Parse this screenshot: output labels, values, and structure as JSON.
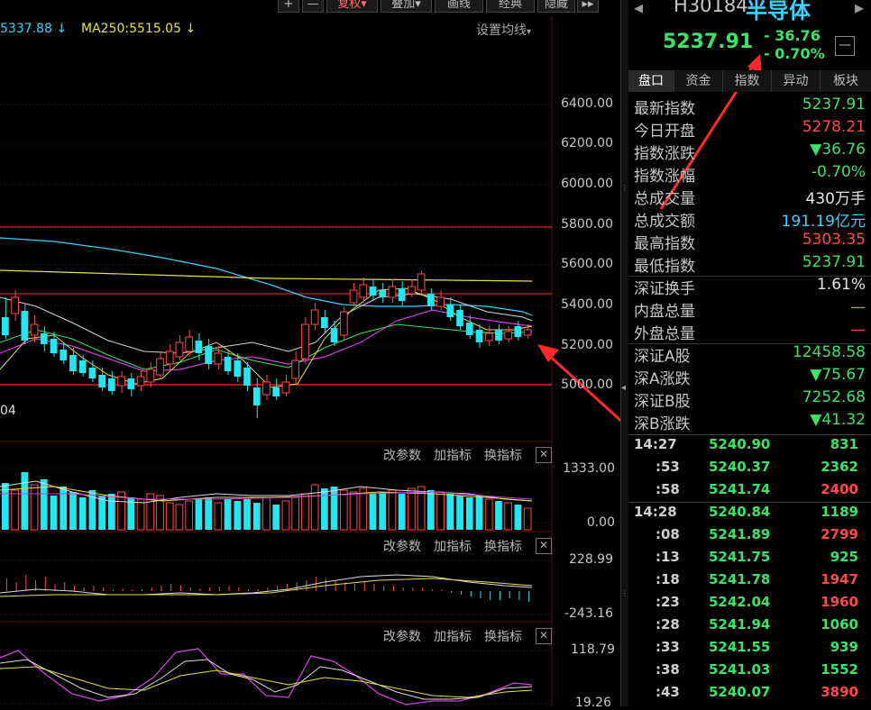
{
  "toolbar": {
    "plus": "+",
    "minus": "—",
    "fuquan": "复权",
    "fuquan_arrow": "▾",
    "overlay": "叠加",
    "overlay_arrow": "▾",
    "draw": "画线",
    "classic": "经典",
    "hide": "隐藏",
    "expand": "▸▸"
  },
  "ma_legend": {
    "ma_a": "5337.88",
    "ma_a_color": "#3bd1ff",
    "ma_a_arrow": "↓",
    "ma250": "MA250:5515.05",
    "ma250_color": "#e8e04a",
    "ma250_arrow": "↓",
    "settings": "设置均线",
    "settings_arrow": "▾"
  },
  "price_axis": [
    "6400.00",
    "6200.00",
    "6000.00",
    "5800.00",
    "5600.00",
    "5400.00",
    "5200.00",
    "5000.00"
  ],
  "date_label": "04",
  "panel_controls": {
    "modify": "改参数",
    "add": "加指标",
    "switch": "换指标",
    "close": "✕"
  },
  "volume_axis": [
    "1333.00",
    "0.00"
  ],
  "macd_axis": [
    "228.99",
    "-243.16"
  ],
  "kdj_axis": [
    "118.79",
    "19.26"
  ],
  "header": {
    "code": "H30184",
    "name": "半导体",
    "price": "5237.91",
    "change": "- 36.76",
    "change_pct": "- 0.70%",
    "collapse": "—"
  },
  "tabs": [
    "盘口",
    "资金",
    "指数",
    "异动",
    "板块"
  ],
  "quote_rows": [
    {
      "label": "最新指数",
      "value": "5237.91",
      "color": "#3ce36a"
    },
    {
      "label": "今日开盘",
      "value": "5278.21",
      "color": "#ff4a4a"
    },
    {
      "label": "指数涨跌",
      "value": "▼36.76",
      "color": "#3ce36a"
    },
    {
      "label": "指数涨幅",
      "value": "-0.70%",
      "color": "#3ce36a"
    },
    {
      "label": "总成交量",
      "value": "430万手",
      "color": "#e6e6e6"
    },
    {
      "label": "总成交额",
      "value": "191.19亿元",
      "color": "#3bd1ff"
    },
    {
      "label": "最高指数",
      "value": "5303.35",
      "color": "#ff4a4a"
    },
    {
      "label": "最低指数",
      "value": "5237.91",
      "color": "#3ce36a"
    }
  ],
  "quote_rows_2": [
    {
      "label": "深证换手",
      "value": "1.61%",
      "color": "#e6e6e6"
    },
    {
      "label": "内盘总量",
      "value": "—",
      "color": "#3ce36a"
    },
    {
      "label": "外盘总量",
      "value": "—",
      "color": "#ff4a4a"
    }
  ],
  "quote_rows_3": [
    {
      "label": "深证A股",
      "value": "12458.58",
      "color": "#3ce36a"
    },
    {
      "label": "深A涨跌",
      "value": "▼75.67",
      "color": "#3ce36a"
    },
    {
      "label": "深证B股",
      "value": "7252.68",
      "color": "#3ce36a"
    },
    {
      "label": "深B涨跌",
      "value": "▼41.32",
      "color": "#3ce36a"
    }
  ],
  "ticks_1": [
    {
      "time": "14:27",
      "price": "5240.90",
      "vol": "831",
      "color": "#3ce36a"
    },
    {
      "time": ":53",
      "price": "5240.37",
      "vol": "2362",
      "color": "#3ce36a"
    },
    {
      "time": ":58",
      "price": "5241.74",
      "vol": "2400",
      "color": "#ff4a4a"
    }
  ],
  "ticks_2": [
    {
      "time": "14:28",
      "price": "5240.84",
      "vol": "1189",
      "color": "#3ce36a"
    },
    {
      "time": ":08",
      "price": "5241.89",
      "vol": "2799",
      "color": "#ff4a4a"
    },
    {
      "time": ":13",
      "price": "5241.75",
      "vol": "925",
      "color": "#3ce36a"
    },
    {
      "time": ":18",
      "price": "5241.78",
      "vol": "1947",
      "color": "#ff4a4a"
    },
    {
      "time": ":23",
      "price": "5242.04",
      "vol": "1960",
      "color": "#ff4a4a"
    },
    {
      "time": ":28",
      "price": "5241.94",
      "vol": "1060",
      "color": "#3ce36a"
    },
    {
      "time": ":33",
      "price": "5241.55",
      "vol": "939",
      "color": "#3ce36a"
    },
    {
      "time": ":38",
      "price": "5241.03",
      "vol": "1552",
      "color": "#3ce36a"
    },
    {
      "time": ":43",
      "price": "5240.07",
      "vol": "3890",
      "color": "#ff4a4a"
    }
  ],
  "colors": {
    "up": "#ff4a4a",
    "down": "#3ce36a",
    "cyan_bar": "#25e6f0",
    "accent": "#3bd1ff",
    "annotation": "#ff2a2a"
  }
}
